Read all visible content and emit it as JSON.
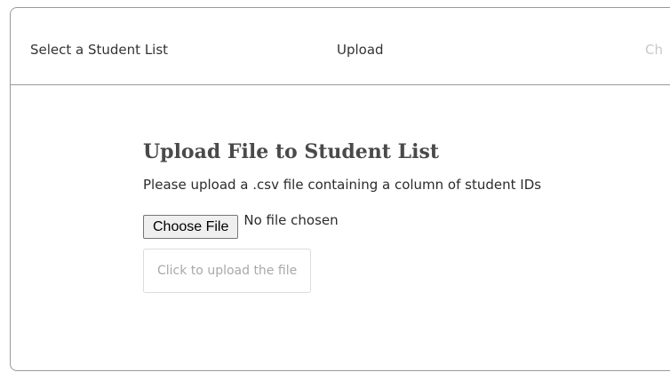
{
  "stepper": {
    "steps": [
      {
        "label": "Select a Student List"
      },
      {
        "label": "Upload"
      },
      {
        "label": "Ch"
      }
    ]
  },
  "upload": {
    "title": "Upload File to Student List",
    "description": "Please upload a .csv file containing a column of student IDs",
    "choose_file_label": "Choose File",
    "file_status": "No file chosen",
    "submit_label": "Click to upload the file"
  },
  "colors": {
    "border": "#9a9a9a",
    "title": "#4a4a4a",
    "disabled_text": "#a8a8a8",
    "future_step": "#c8c8c8"
  }
}
